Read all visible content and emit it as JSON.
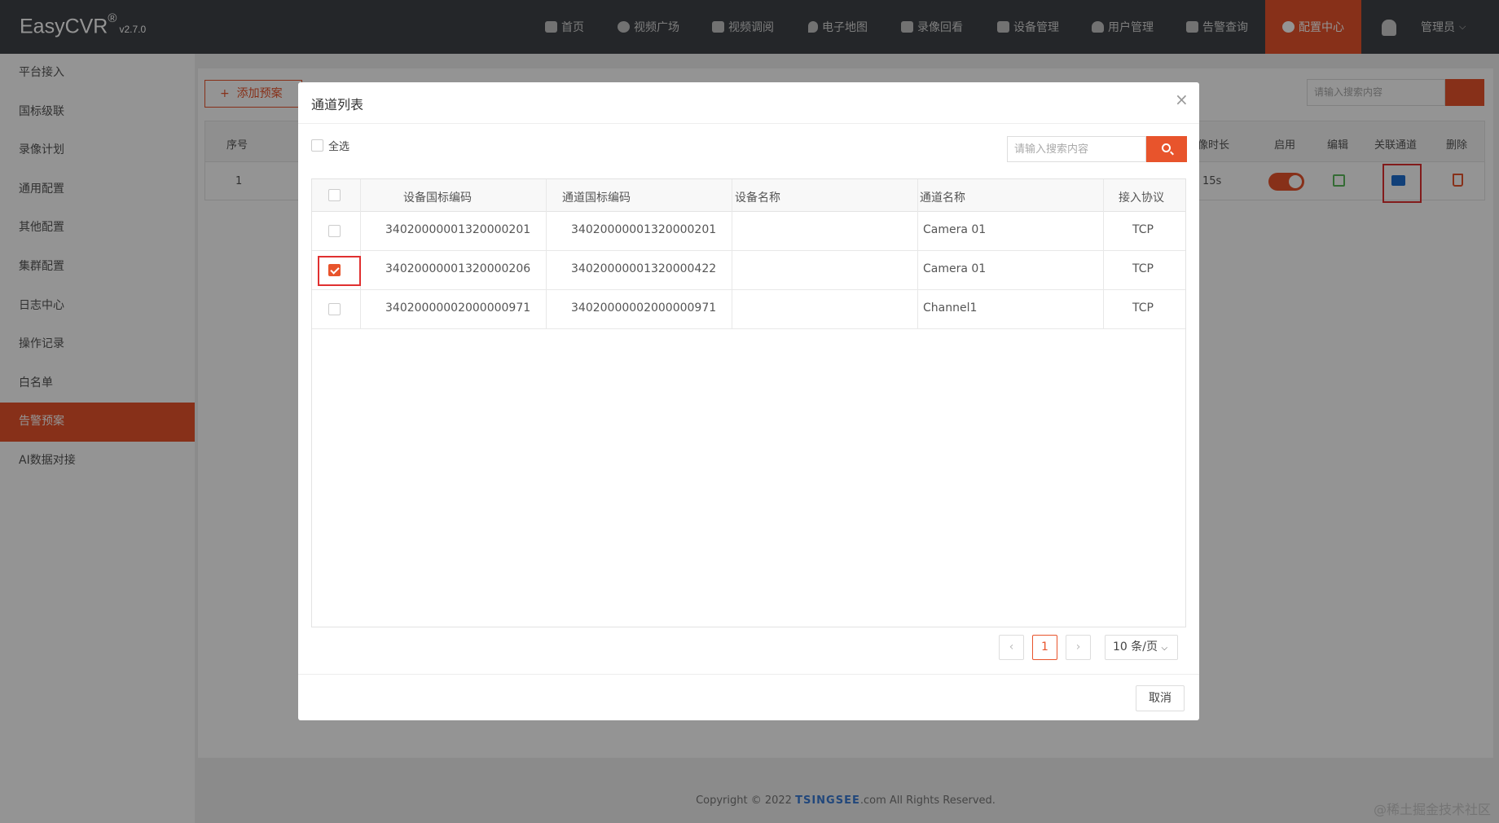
{
  "app": {
    "name": "EasyCVR",
    "reg": "®",
    "version": "v2.7.0"
  },
  "nav": {
    "items": [
      {
        "label": "首页",
        "icon": "dashboard-icon"
      },
      {
        "label": "视频广场",
        "icon": "play-icon"
      },
      {
        "label": "视频调阅",
        "icon": "grid-icon"
      },
      {
        "label": "电子地图",
        "icon": "map-pin-icon"
      },
      {
        "label": "录像回看",
        "icon": "video-camera-icon"
      },
      {
        "label": "设备管理",
        "icon": "device-icon"
      },
      {
        "label": "用户管理",
        "icon": "user-icon"
      },
      {
        "label": "告警查询",
        "icon": "alarm-icon"
      },
      {
        "label": "配置中心",
        "icon": "gear-icon"
      }
    ],
    "active": "配置中心",
    "user": "管理员"
  },
  "sidebar": {
    "items": [
      "平台接入",
      "国标级联",
      "录像计划",
      "通用配置",
      "其他配置",
      "集群配置",
      "日志中心",
      "操作记录",
      "白名单",
      "告警预案",
      "AI数据对接"
    ],
    "active": "告警预案"
  },
  "background": {
    "add_button": "添加预案",
    "search_placeholder": "请输入搜索内容",
    "columns": {
      "index": "序号",
      "duration": "像时长",
      "enable": "启用",
      "edit": "编辑",
      "link": "关联通道",
      "delete": "删除"
    },
    "row": {
      "index": "1",
      "duration": "15s",
      "enabled": true
    }
  },
  "modal": {
    "title": "通道列表",
    "select_all": "全选",
    "search_placeholder": "请输入搜索内容",
    "columns": [
      "设备国标编码",
      "通道国标编码",
      "设备名称",
      "通道名称",
      "接入协议"
    ],
    "rows": [
      {
        "device_code": "34020000001320000201",
        "channel_code": "34020000001320000201",
        "device_name": "",
        "channel_name": "Camera 01",
        "protocol": "TCP",
        "checked": false
      },
      {
        "device_code": "34020000001320000206",
        "channel_code": "34020000001320000422",
        "device_name": "",
        "channel_name": "Camera 01",
        "protocol": "TCP",
        "checked": true
      },
      {
        "device_code": "34020000002000000971",
        "channel_code": "34020000002000000971",
        "device_name": "",
        "channel_name": "Channel1",
        "protocol": "TCP",
        "checked": false
      }
    ],
    "pager": {
      "prev": "‹",
      "page": "1",
      "next": "›",
      "page_size": "10 条/页"
    },
    "cancel": "取消"
  },
  "footer": {
    "prefix": "Copyright © 2022 ",
    "brand": "TSINGSEE",
    "suffix": ".com All Rights Reserved."
  },
  "watermark": "@稀土掘金技术社区",
  "colors": {
    "accent": "#e8542c",
    "topbar": "#3f4247",
    "highlight": "#e03030"
  }
}
